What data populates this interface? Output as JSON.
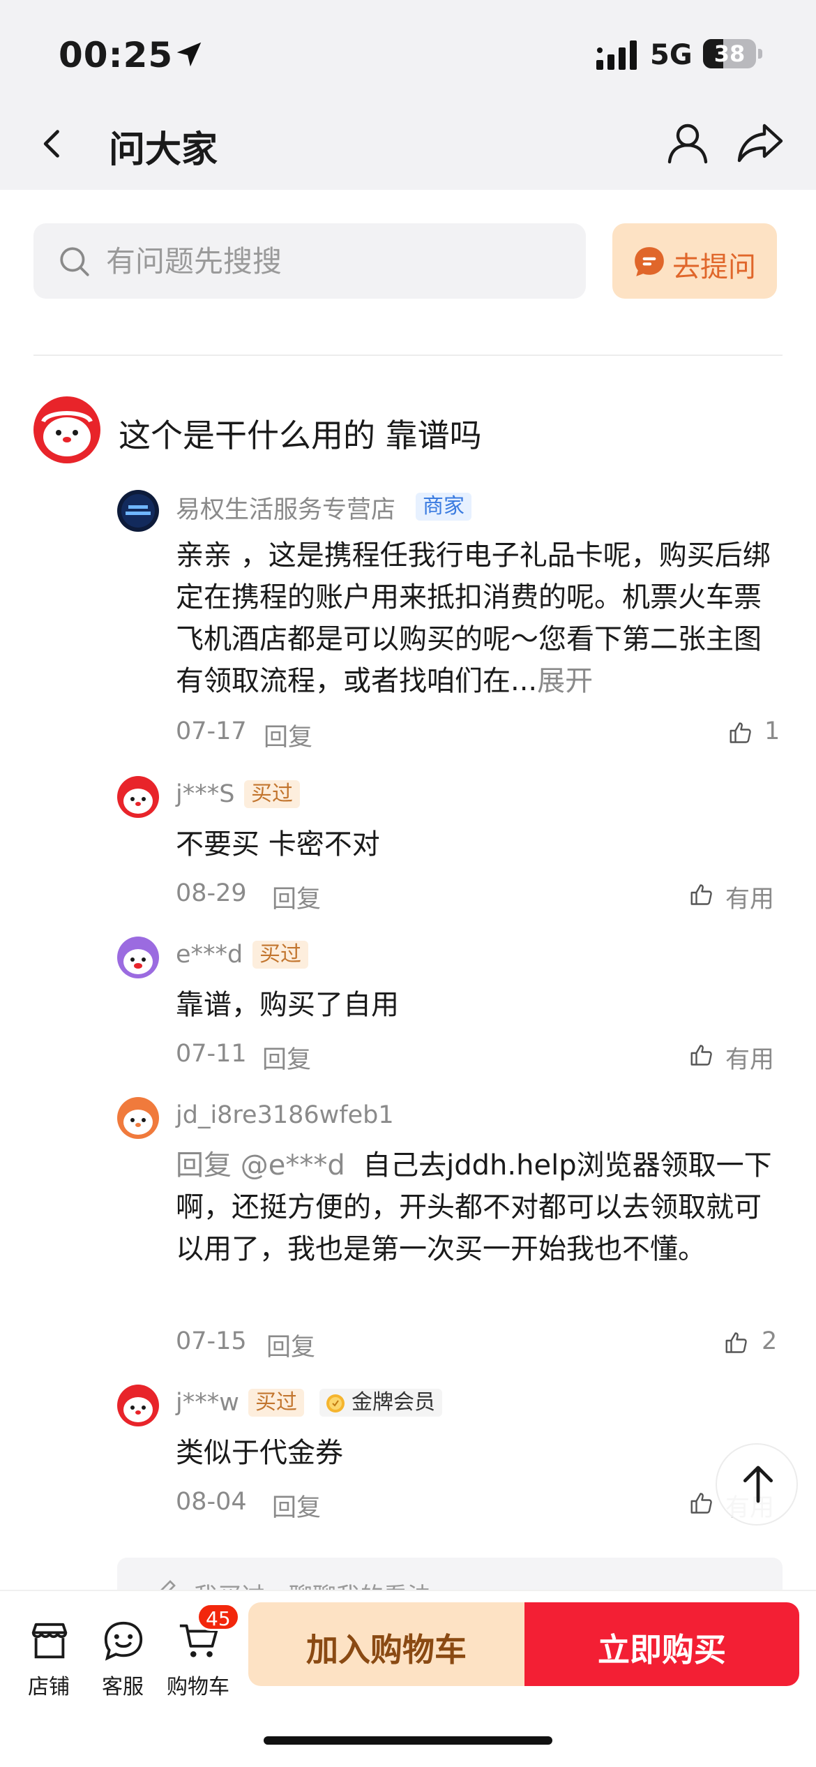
{
  "status_bar": {
    "time": "00:25",
    "network": "5G",
    "battery": "38",
    "battery_level": 0.38
  },
  "header": {
    "title": "问大家"
  },
  "search": {
    "placeholder": "有问题先搜搜"
  },
  "ask_button": {
    "label": "去提问"
  },
  "question": {
    "text": "这个是干什么用的 靠谱吗"
  },
  "answers": [
    {
      "name": "易权生活服务专营店",
      "tag": "商家",
      "text": "亲亲 ，这是携程任我行电子礼品卡呢，购买后绑定在携程的账户用来抵扣消费的呢。机票火车票飞机酒店都是可以购买的呢～您看下第二张主图有领取流程，或者找咱们在...",
      "more": "展开",
      "date": "07-17",
      "reply": "回复",
      "likes": "1"
    },
    {
      "name": "j***S",
      "tag": "买过",
      "text": "不要买 卡密不对",
      "date": "08-29",
      "reply": "回复",
      "likes": "有用"
    },
    {
      "name": "e***d",
      "tag": "买过",
      "text": "靠谱，购买了自用",
      "date": "07-11",
      "reply": "回复",
      "likes": "有用"
    },
    {
      "name": "jd_i8re3186wfeb1",
      "mention": "回复 @e***d",
      "text": "自己去jddh.help浏览器领取一下啊，还挺方便的，开头都不对都可以去领取就可以用了，我也是第一次买一开始我也不懂。",
      "date": "07-15",
      "reply": "回复",
      "likes": "2"
    },
    {
      "name": "j***w",
      "tag": "买过",
      "badge": "金牌会员",
      "text": "类似于代金券",
      "date": "08-04",
      "reply": "回复",
      "likes": "有用"
    }
  ],
  "comment_box": {
    "placeholder": "我买过，聊聊我的看法"
  },
  "bottom_bar": {
    "shop": "店铺",
    "service": "客服",
    "cart": "购物车",
    "cart_count": "45",
    "add_to_cart": "加入购物车",
    "buy_now": "立即购买"
  },
  "colors": {
    "accent_red": "#f31f34",
    "accent_orange": "#e0662a",
    "cart_bg": "#fde2c4"
  }
}
